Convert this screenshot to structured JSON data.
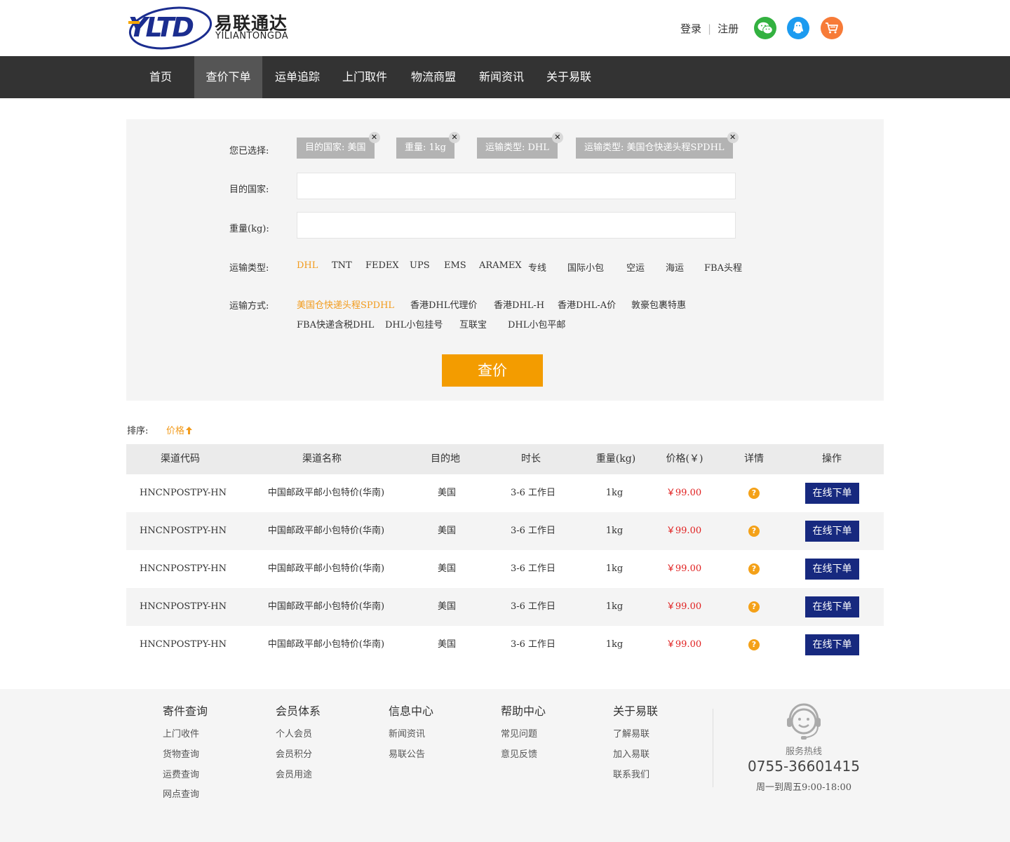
{
  "brand": {
    "name_cn": "易联通达",
    "name_en": "YILIANTONGDA",
    "logo_letters": "YLTD"
  },
  "header": {
    "login": "登录",
    "register": "注册",
    "social": [
      "wechat-icon",
      "qq-icon",
      "cart-icon"
    ],
    "colors": {
      "wechat": "#33b140",
      "qq": "#1c9bf0",
      "cart": "#f77b38"
    }
  },
  "nav": {
    "items": [
      "首页",
      "查价下单",
      "运单追踪",
      "上门取件",
      "物流商盟",
      "新闻资讯",
      "关于易联"
    ],
    "active": "查价下单"
  },
  "filter": {
    "selected_label": "您已选择:",
    "chips": [
      "目的国家: 美国",
      "重量: 1kg",
      "运输类型: DHL",
      "运输类型: 美国仓快递头程SPDHL"
    ],
    "country_label": "目的国家:",
    "country_value": "",
    "weight_label": "重量(kg):",
    "weight_value": "",
    "type_label": "运输类型:",
    "types": [
      "DHL",
      "TNT",
      "FEDEX",
      "UPS",
      "EMS",
      "ARAMEX",
      "专线",
      "国际小包",
      "空运",
      "海运",
      "FBA头程"
    ],
    "type_selected": "DHL",
    "method_label": "运输方式:",
    "methods_row1": [
      "美国仓快递头程SPDHL",
      "香港DHL代理价",
      "香港DHL-H",
      "香港DHL-A价",
      "敦豪包裹特惠"
    ],
    "methods_row2": [
      "FBA快递含税DHL",
      "DHL小包挂号",
      "互联宝",
      "DHL小包平邮"
    ],
    "method_selected": "美国仓快递头程SPDHL",
    "search_button": "查价",
    "accent": "#f39c00"
  },
  "sort": {
    "label": "排序:",
    "price": "价格",
    "direction_icon": "arrow-up-icon"
  },
  "table": {
    "headers": [
      "渠道代码",
      "渠道名称",
      "目的地",
      "时长",
      "重量(kg)",
      "价格(￥)",
      "详情",
      "操作"
    ],
    "rows": [
      {
        "code": "HNCNPOSTPY-HN",
        "name": "中国邮政平邮小包特价(华南)",
        "dest": "美国",
        "duration": "3-6 工作日",
        "weight": "1kg",
        "price": "￥99.00",
        "action": "在线下单"
      },
      {
        "code": "HNCNPOSTPY-HN",
        "name": "中国邮政平邮小包特价(华南)",
        "dest": "美国",
        "duration": "3-6 工作日",
        "weight": "1kg",
        "price": "￥99.00",
        "action": "在线下单"
      },
      {
        "code": "HNCNPOSTPY-HN",
        "name": "中国邮政平邮小包特价(华南)",
        "dest": "美国",
        "duration": "3-6 工作日",
        "weight": "1kg",
        "price": "￥99.00",
        "action": "在线下单"
      },
      {
        "code": "HNCNPOSTPY-HN",
        "name": "中国邮政平邮小包特价(华南)",
        "dest": "美国",
        "duration": "3-6 工作日",
        "weight": "1kg",
        "price": "￥99.00",
        "action": "在线下单"
      },
      {
        "code": "HNCNPOSTPY-HN",
        "name": "中国邮政平邮小包特价(华南)",
        "dest": "美国",
        "duration": "3-6 工作日",
        "weight": "1kg",
        "price": "￥99.00",
        "action": "在线下单"
      }
    ],
    "price_color": "#e02020",
    "button_color": "#17297f"
  },
  "footer": {
    "columns": [
      {
        "title": "寄件查询",
        "links": [
          "上门收件",
          "货物查询",
          "运费查询",
          "网点查询"
        ]
      },
      {
        "title": "会员体系",
        "links": [
          "个人会员",
          "会员积分",
          "会员用途"
        ]
      },
      {
        "title": "信息中心",
        "links": [
          "新闻资讯",
          "易联公告"
        ]
      },
      {
        "title": "帮助中心",
        "links": [
          "常见问题",
          "意见反馈"
        ]
      },
      {
        "title": "关于易联",
        "links": [
          "了解易联",
          "加入易联",
          "联系我们"
        ]
      }
    ],
    "hotline_label": "服务热线",
    "hotline_number": "0755-36601415",
    "hotline_hours": "周一到周五9:00-18:00"
  }
}
